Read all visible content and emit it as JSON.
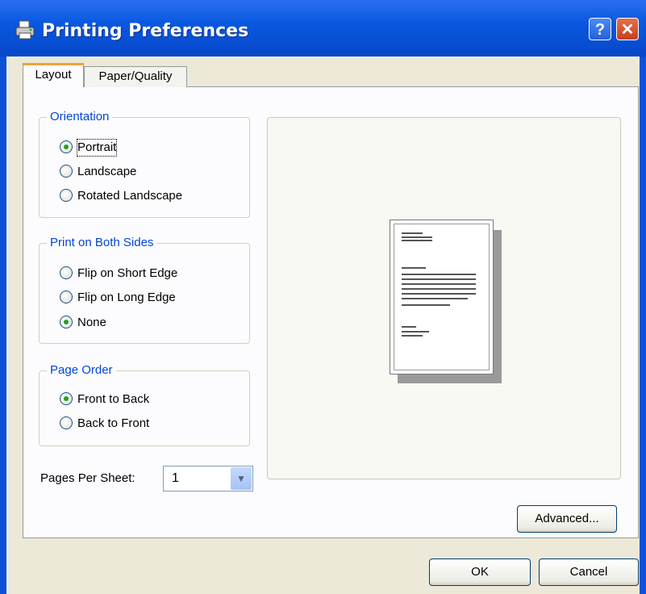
{
  "window": {
    "title": "Printing Preferences"
  },
  "titlebar_buttons": {
    "help": "?",
    "close": "✕"
  },
  "tabs": [
    {
      "label": "Layout"
    },
    {
      "label": "Paper/Quality"
    }
  ],
  "orientation": {
    "legend": "Orientation",
    "options": [
      {
        "label": "Portrait",
        "selected": true
      },
      {
        "label": "Landscape",
        "selected": false
      },
      {
        "label": "Rotated Landscape",
        "selected": false
      }
    ]
  },
  "print_both_sides": {
    "legend": "Print on Both Sides",
    "options": [
      {
        "label": "Flip on Short Edge",
        "selected": false
      },
      {
        "label": "Flip on Long Edge",
        "selected": false
      },
      {
        "label": "None",
        "selected": true
      }
    ]
  },
  "page_order": {
    "legend": "Page Order",
    "options": [
      {
        "label": "Front to Back",
        "selected": true
      },
      {
        "label": "Back to Front",
        "selected": false
      }
    ]
  },
  "pages_per_sheet": {
    "label": "Pages Per Sheet:",
    "value": "1"
  },
  "buttons": {
    "advanced": "Advanced...",
    "ok": "OK",
    "cancel": "Cancel"
  },
  "colors": {
    "title_bar": "#0a58e0",
    "dialog_bg": "#ece9d8",
    "group_label": "#0046d5",
    "radio_dot": "#21a121",
    "tab_accent": "#f0a23a"
  },
  "icons": {
    "app": "printer-icon"
  }
}
